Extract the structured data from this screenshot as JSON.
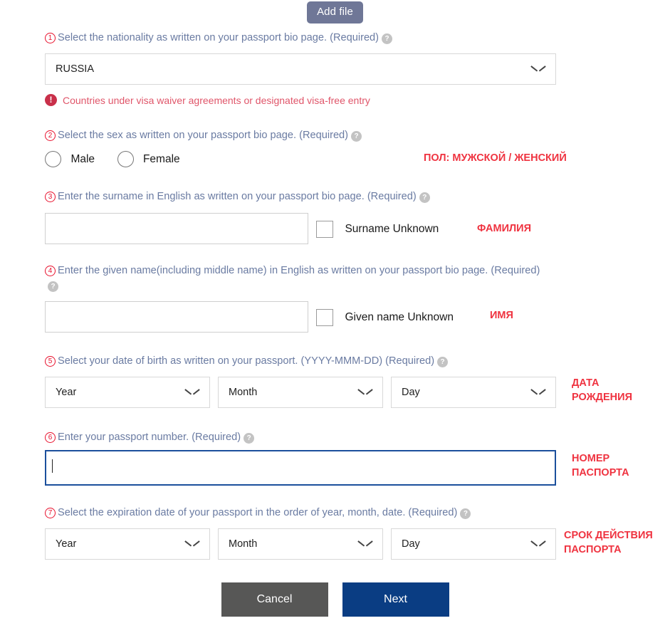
{
  "toolbar": {
    "add_file_label": "Add file"
  },
  "questions": [
    {
      "num": "1",
      "label": "Select the nationality as written on your passport bio page. (Required)",
      "help_icon": "help-icon",
      "value": "RUSSIA"
    },
    {
      "num": "2",
      "label": "Select the sex as written on your passport bio page. (Required)",
      "options": [
        "Male",
        "Female"
      ]
    },
    {
      "num": "3",
      "label": "Enter the surname in English as written on your passport bio page. (Required)",
      "value": "",
      "checkbox_label": "Surname Unknown"
    },
    {
      "num": "4",
      "label": "Enter the given name(including middle name) in English as written on your passport bio page. (Required)",
      "value": "",
      "checkbox_label": "Given name Unknown"
    },
    {
      "num": "5",
      "label": "Select your date of birth as written on your passport. (YYYY-MMM-DD) (Required)",
      "year": "Year",
      "month": "Month",
      "day": "Day"
    },
    {
      "num": "6",
      "label": "Enter your passport number. (Required)",
      "value": ""
    },
    {
      "num": "7",
      "label": "Select the expiration date of your passport in the order of year, month, date. (Required)",
      "year": "Year",
      "month": "Month",
      "day": "Day"
    }
  ],
  "warning": {
    "icon": "exclamation-circle-icon",
    "text": "Countries under visa waiver agreements or designated visa-free entry"
  },
  "annotations": {
    "sex": "ПОЛ: МУЖСКОЙ / ЖЕНСКИЙ",
    "surname": "ФАМИЛИЯ",
    "given_name": "ИМЯ",
    "birth_date": "ДАТА\nРОЖДЕНИЯ",
    "passport_number": "НОМЕР\nПАСПОРТА",
    "expiry": "СРОК ДЕЙСТВИЯ\nПАСПОРТА"
  },
  "footer": {
    "cancel_label": "Cancel",
    "next_label": "Next"
  },
  "colors": {
    "accent_red": "#ef3340",
    "label_blue": "#6a7ba2",
    "next_blue": "#0a3d83",
    "cancel_gray": "#575756",
    "addfile_slate": "#6f7797",
    "warning_red": "#c9304a"
  }
}
